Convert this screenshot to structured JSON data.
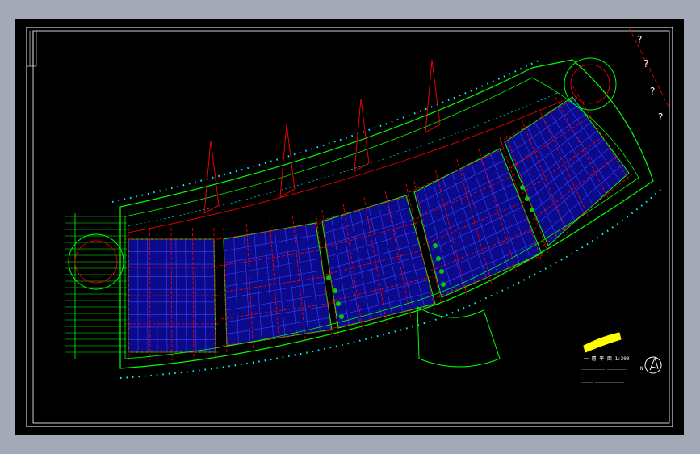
{
  "window": {
    "title": "",
    "background": "#a3a9b6",
    "canvas_color": "#000000"
  },
  "colors": {
    "frame": "#ffffff",
    "walls": "#00ff00",
    "axis": "#ff0000",
    "grid_fill": "#0a0a8a",
    "grid_line": "#4040ff",
    "columns": "#00ffff",
    "trees": "#00cc00",
    "titleblock": "#ffff00"
  },
  "drawing": {
    "legend_title": "一 層 平 面  1:300",
    "notes": [
      "__________ ________",
      "______ ___________",
      "_____ ____________",
      "_______ ____"
    ],
    "north_label": "N",
    "question_marks": [
      "?",
      "?",
      "?",
      "?"
    ]
  }
}
